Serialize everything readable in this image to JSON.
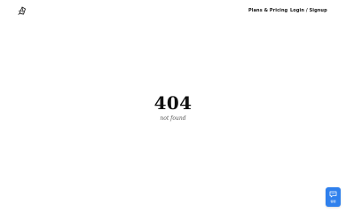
{
  "header": {
    "logo_icon": "pencil-nib-logo-icon",
    "nav": {
      "plans_pricing": "Plans & Pricing",
      "login_signup": "Login / Signup"
    }
  },
  "error": {
    "code": "404",
    "message": "not found"
  },
  "chat_widget": {
    "icon": "chat-icon",
    "label": "客服",
    "color": "#2f80ed"
  }
}
